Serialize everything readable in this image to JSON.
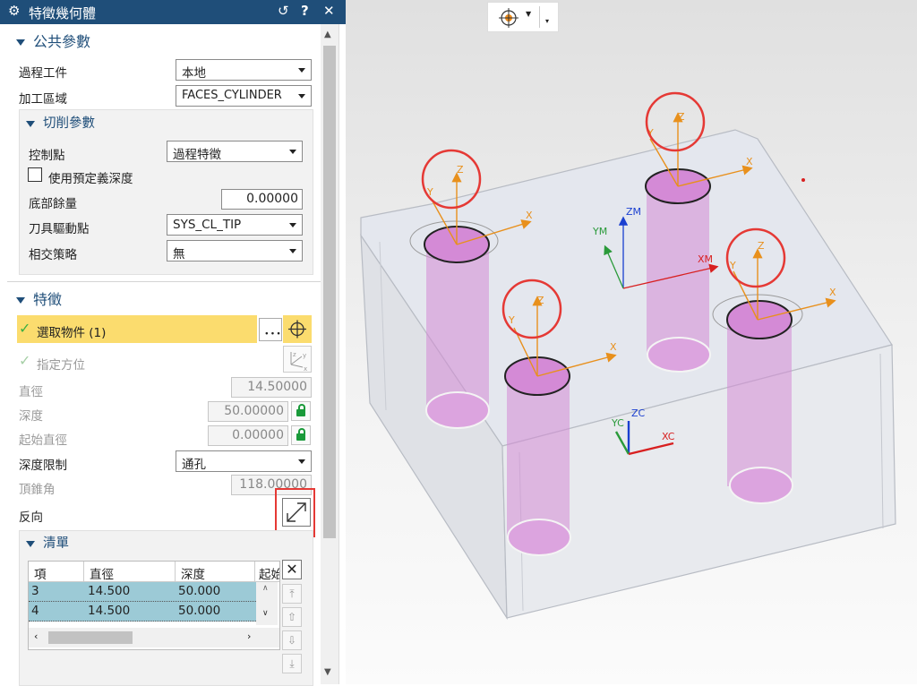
{
  "dialog": {
    "title": "特徵幾何體",
    "icons": {
      "settings": "gear-icon",
      "reset": "reset-icon",
      "help": "help-icon",
      "close": "close-icon"
    },
    "help_glyph": "?",
    "close_glyph": "✕",
    "reset_glyph": "↺"
  },
  "common_params": {
    "header": "公共參數",
    "process_work_label": "過程工件",
    "process_work_value": "本地",
    "machining_area_label": "加工區域",
    "machining_area_value": "FACES_CYLINDER",
    "cutting": {
      "header": "切削參數",
      "control_point_label": "控制點",
      "control_point_value": "過程特徵",
      "predefined_depth_label": "使用預定義深度",
      "predefined_depth_checked": false,
      "floor_stock_label": "底部餘量",
      "floor_stock_value": "0.00000",
      "tool_drive_point_label": "刀具驅動點",
      "tool_drive_point_value": "SYS_CL_TIP",
      "intersection_label": "相交策略",
      "intersection_value": "無"
    }
  },
  "feature": {
    "header": "特徵",
    "select_object_label": "選取物件 (1)",
    "specify_orientation_label": "指定方位",
    "diameter_label": "直徑",
    "diameter_value": "14.50000",
    "depth_label": "深度",
    "depth_value": "50.00000",
    "start_diameter_label": "起始直徑",
    "start_diameter_value": "0.00000",
    "depth_limit_label": "深度限制",
    "depth_limit_value": "通孔",
    "tip_angle_label": "頂錐角",
    "tip_angle_value": "118.00000",
    "reverse_label": "反向"
  },
  "list": {
    "header": "清單",
    "columns": [
      "項",
      "直徑",
      "深度",
      "起始"
    ],
    "rows": [
      {
        "item": "3",
        "diameter": "14.500",
        "depth": "50.000"
      },
      {
        "item": "4",
        "diameter": "14.500",
        "depth": "50.000"
      }
    ]
  },
  "viewport": {
    "labels": {
      "z": "Z",
      "x": "X",
      "y": "Y",
      "zm": "ZM",
      "ym": "YM",
      "xm": "XM",
      "zc": "ZC",
      "yc": "YC",
      "xc": "XC"
    }
  },
  "colors": {
    "title_bar": "#1f4e79",
    "accent": "#1f4e79",
    "selected_row": "#fbdc6e",
    "table_row": "#9ccad6",
    "highlight_box": "#e53935",
    "hole_fill": "#d48ad6",
    "axis_orange": "#e8901c"
  }
}
